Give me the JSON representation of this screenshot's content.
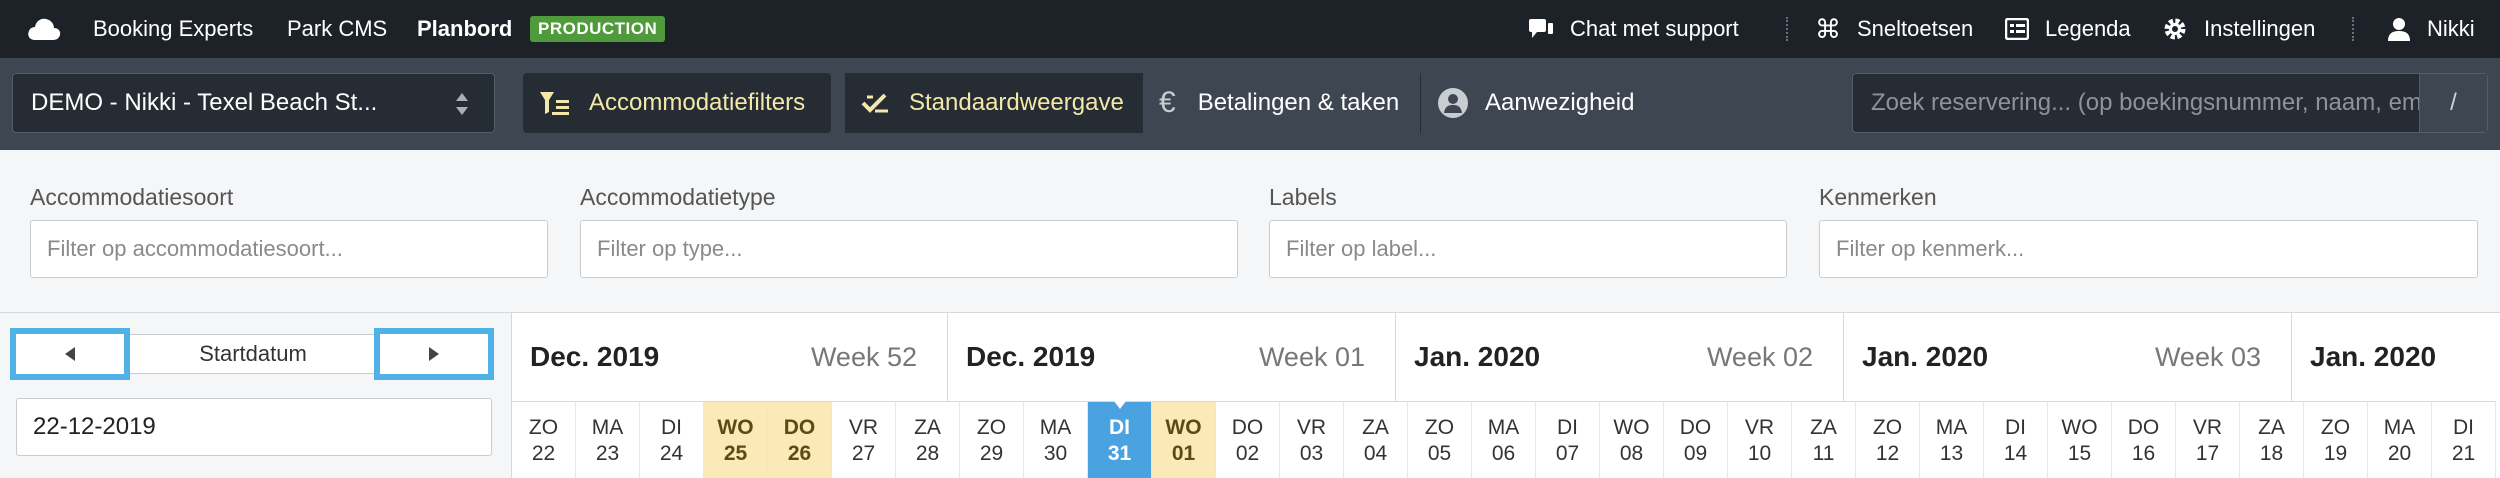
{
  "topnav": {
    "apps": [
      {
        "label": "Booking Experts"
      },
      {
        "label": "Park CMS"
      },
      {
        "label": "Planbord"
      }
    ],
    "env_badge": "PRODUCTION",
    "right": {
      "support": "Chat met support",
      "shortcuts": "Sneltoetsen",
      "legend": "Legenda",
      "settings": "Instellingen",
      "user": "Nikki"
    }
  },
  "toolbar": {
    "park_select": "DEMO - Nikki - Texel Beach St...",
    "filters_btn": "Accommodatiefilters",
    "views": [
      "Standaardweergave",
      "Betalingen & taken",
      "Aanwezigheid"
    ],
    "search_placeholder": "Zoek reservering... (op boekingsnummer, naam, em",
    "search_key": "/"
  },
  "filters": [
    {
      "label": "Accommodatiesoort",
      "placeholder": "Filter op accommodatiesoort..."
    },
    {
      "label": "Accommodatietype",
      "placeholder": "Filter op type..."
    },
    {
      "label": "Labels",
      "placeholder": "Filter op label..."
    },
    {
      "label": "Kenmerken",
      "placeholder": "Filter op kenmerk..."
    }
  ],
  "planning": {
    "startdatum_label": "Startdatum",
    "date_value": "22-12-2019",
    "weeks": [
      {
        "month": "Dec. 2019",
        "week": "Week 52"
      },
      {
        "month": "Dec. 2019",
        "week": "Week 01"
      },
      {
        "month": "Jan. 2020",
        "week": "Week 02"
      },
      {
        "month": "Jan. 2020",
        "week": "Week 03"
      },
      {
        "month": "Jan. 2020",
        "week": ""
      }
    ],
    "days": [
      {
        "d": "ZO",
        "n": "22"
      },
      {
        "d": "MA",
        "n": "23"
      },
      {
        "d": "DI",
        "n": "24"
      },
      {
        "d": "WO",
        "n": "25",
        "t": "hol"
      },
      {
        "d": "DO",
        "n": "26",
        "t": "hol"
      },
      {
        "d": "VR",
        "n": "27"
      },
      {
        "d": "ZA",
        "n": "28"
      },
      {
        "d": "ZO",
        "n": "29"
      },
      {
        "d": "MA",
        "n": "30"
      },
      {
        "d": "DI",
        "n": "31",
        "t": "today"
      },
      {
        "d": "WO",
        "n": "01",
        "t": "hol"
      },
      {
        "d": "DO",
        "n": "02"
      },
      {
        "d": "VR",
        "n": "03"
      },
      {
        "d": "ZA",
        "n": "04"
      },
      {
        "d": "ZO",
        "n": "05"
      },
      {
        "d": "MA",
        "n": "06"
      },
      {
        "d": "DI",
        "n": "07"
      },
      {
        "d": "WO",
        "n": "08"
      },
      {
        "d": "DO",
        "n": "09"
      },
      {
        "d": "VR",
        "n": "10"
      },
      {
        "d": "ZA",
        "n": "11"
      },
      {
        "d": "ZO",
        "n": "12"
      },
      {
        "d": "MA",
        "n": "13"
      },
      {
        "d": "DI",
        "n": "14"
      },
      {
        "d": "WO",
        "n": "15"
      },
      {
        "d": "DO",
        "n": "16"
      },
      {
        "d": "VR",
        "n": "17"
      },
      {
        "d": "ZA",
        "n": "18"
      },
      {
        "d": "ZO",
        "n": "19"
      },
      {
        "d": "MA",
        "n": "20"
      },
      {
        "d": "DI",
        "n": "21"
      }
    ]
  },
  "colors": {
    "nav_bg": "#1d2229",
    "toolbar_bg": "#3e4751",
    "accent_yellow": "#f3e8a9",
    "today_blue": "#4aa3e0",
    "holiday": "#fce9b8",
    "badge_green": "#4f9a3a"
  }
}
